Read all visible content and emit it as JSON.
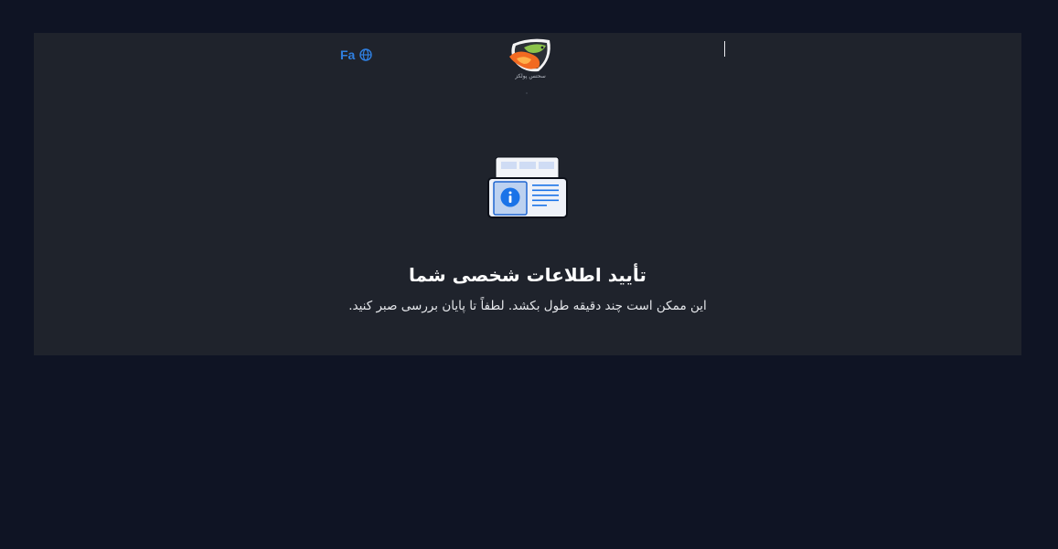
{
  "header": {
    "language_label": "Fa",
    "logo_caption": "سحتس پولکز"
  },
  "main": {
    "title": "تأیید اطلاعات شخصی شما",
    "subtitle": "این ممکن است چند دقیقه طول بکشد. لطفاً تا پایان بررسی صبر کنید."
  },
  "icons": {
    "language": "globe-icon",
    "logo": "brand-logo-icon",
    "illustration": "id-verification-icon",
    "info": "info-icon"
  },
  "colors": {
    "page_background": "#0f1424",
    "card_background": "#1f232c",
    "accent": "#2f7fe0",
    "title": "#ffffff"
  }
}
